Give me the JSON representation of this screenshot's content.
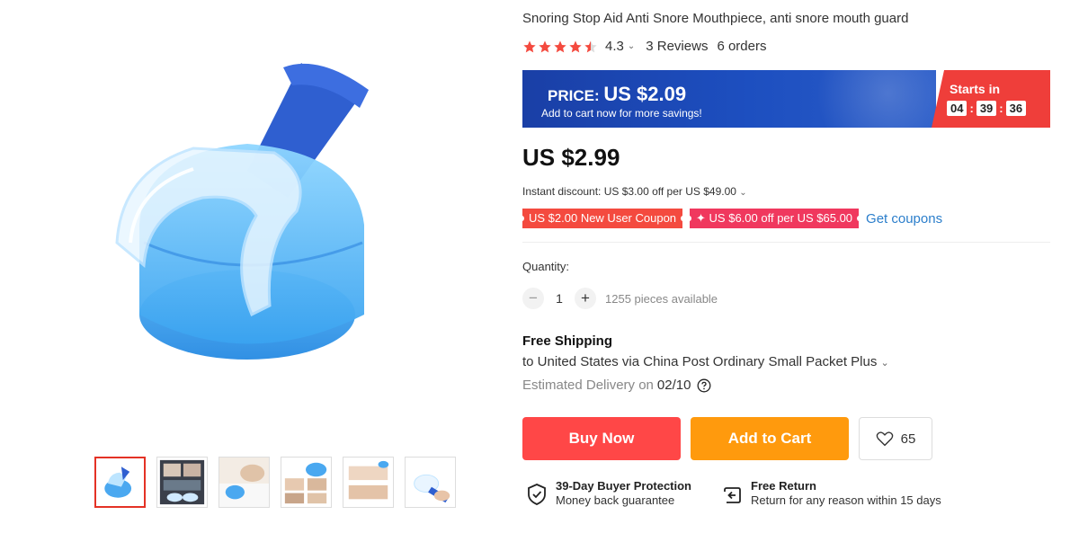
{
  "product": {
    "title": "Snoring Stop Aid Anti Snore Mouthpiece, anti snore mouth guard",
    "rating": "4.3",
    "stars": 4.5,
    "reviews": "3 Reviews",
    "orders": "6 orders"
  },
  "banner": {
    "price_label": "PRICE:",
    "price_value": "US $2.09",
    "subtext": "Add to cart now for more savings!",
    "starts_in": "Starts in",
    "timer": [
      "04",
      "39",
      "36"
    ],
    "colors": {
      "blue": "#1d4fc0",
      "red": "#ef3e3a"
    }
  },
  "price": "US $2.99",
  "instant_discount": "Instant discount: US $3.00 off per US $49.00",
  "coupons": {
    "new_user": "US $2.00 New User Coupon",
    "store": "US $6.00 off per US $65.00",
    "get_coupons": "Get coupons"
  },
  "quantity": {
    "label": "Quantity:",
    "minus": "−",
    "value": "1",
    "plus": "+",
    "available": "1255 pieces available"
  },
  "shipping": {
    "title": "Free Shipping",
    "to": "to United States via China Post Ordinary Small Packet Plus",
    "estimated_label": "Estimated Delivery on",
    "estimated_date": "02/10"
  },
  "actions": {
    "buy_now": "Buy Now",
    "add_to_cart": "Add to Cart",
    "wishlist_count": "65",
    "colors": {
      "buy": "#ff4747",
      "cart": "#ff9a0d"
    }
  },
  "guarantees": {
    "protection_title": "39-Day Buyer Protection",
    "protection_sub": "Money back guarantee",
    "return_title": "Free Return",
    "return_sub": "Return for any reason within 15 days"
  },
  "gallery": {
    "thumbnail_icons": [
      "product-thumb",
      "box-thumb",
      "sleeper-thumb",
      "collage-thumb",
      "couple-thumb",
      "hand-thumb"
    ],
    "active_index": 0
  }
}
